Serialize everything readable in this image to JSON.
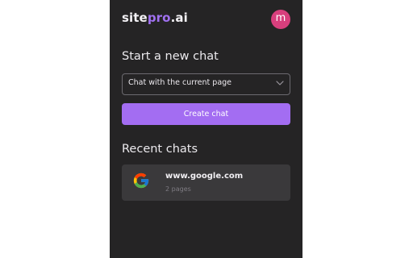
{
  "header": {
    "logo_prefix": "site",
    "logo_accent": "pro",
    "logo_suffix": ".ai",
    "avatar_initial": "m"
  },
  "new_chat": {
    "title": "Start a new chat",
    "select_value": "Chat with the current page",
    "create_label": "Create chat"
  },
  "recent": {
    "title": "Recent chats",
    "items": [
      {
        "title": "www.google.com",
        "subtitle": "2 pages",
        "icon": "google-icon"
      }
    ]
  },
  "colors": {
    "panel_bg": "#252425",
    "accent": "#a36df2",
    "avatar": "#d83f7d",
    "card_bg": "#3a393b"
  }
}
